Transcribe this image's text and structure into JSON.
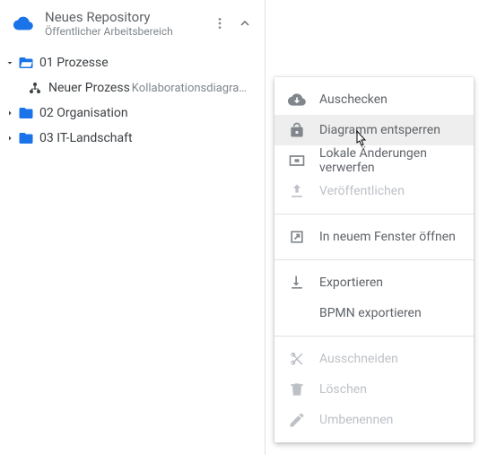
{
  "repo": {
    "title": "Neues Repository",
    "subtitle": "Öffentlicher Arbeitsbereich"
  },
  "tree": {
    "items": [
      {
        "label": "01 Prozesse",
        "expanded": true,
        "type": "folder",
        "children": [
          {
            "label": "Neuer Prozess",
            "sublabel": "Kollaborationsdiagra…",
            "type": "diagram"
          }
        ]
      },
      {
        "label": "02 Organisation",
        "expanded": false,
        "type": "folder"
      },
      {
        "label": "03 IT-Landschaft",
        "expanded": false,
        "type": "folder"
      }
    ]
  },
  "contextMenu": {
    "groups": [
      [
        {
          "label": "Auschecken",
          "icon": "cloud-download",
          "enabled": true,
          "highlight": false
        },
        {
          "label": "Diagramm entsperren",
          "icon": "lock-open",
          "enabled": true,
          "highlight": true
        },
        {
          "label": "Lokale Änderungen verwerfen",
          "icon": "discard",
          "enabled": true,
          "highlight": false
        },
        {
          "label": "Veröffentlichen",
          "icon": "upload",
          "enabled": false,
          "highlight": false
        }
      ],
      [
        {
          "label": "In neuem Fenster öffnen",
          "icon": "open-new",
          "enabled": true,
          "highlight": false
        }
      ],
      [
        {
          "label": "Exportieren",
          "icon": "download",
          "enabled": true,
          "highlight": false
        },
        {
          "label": "BPMN exportieren",
          "icon": "",
          "enabled": true,
          "highlight": false
        }
      ],
      [
        {
          "label": "Ausschneiden",
          "icon": "cut",
          "enabled": false,
          "highlight": false
        },
        {
          "label": "Löschen",
          "icon": "delete",
          "enabled": false,
          "highlight": false
        },
        {
          "label": "Umbenennen",
          "icon": "edit",
          "enabled": false,
          "highlight": false
        }
      ]
    ]
  }
}
